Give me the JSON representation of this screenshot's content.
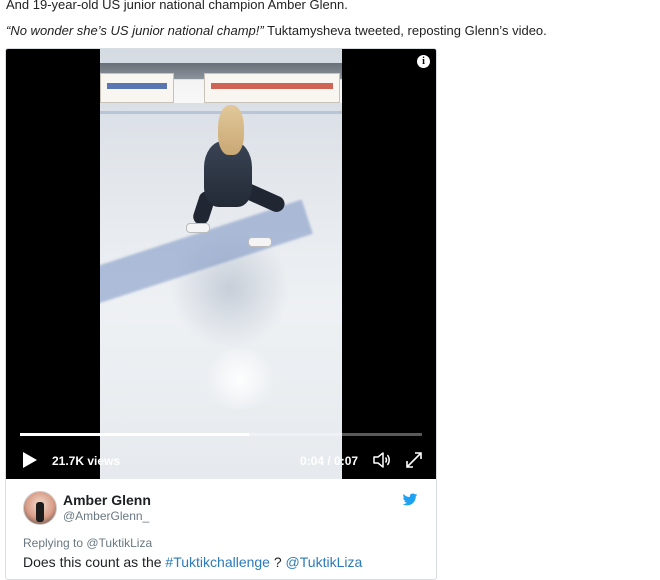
{
  "article": {
    "line1": "And 19-year-old US junior national champion Amber Glenn.",
    "quote": "“No wonder she’s US junior national champ!”",
    "line2_rest": " Tuktamysheva tweeted, reposting Glenn’s video."
  },
  "video": {
    "views": "21.7K views",
    "time": "0:04 / 0:07",
    "progress_fraction": 0.57,
    "info_icon": "i"
  },
  "tweet": {
    "display_name": "Amber Glenn",
    "handle": "@AmberGlenn_",
    "replying_to": "Replying to @TuktikLiza",
    "text_prefix": "Does this count as the ",
    "hashtag": "#Tuktikchallenge",
    "text_middle": " ? ",
    "mention": "@TuktikLiza",
    "link_color": "#2b7bb9",
    "bird_color": "#1da1f2"
  }
}
